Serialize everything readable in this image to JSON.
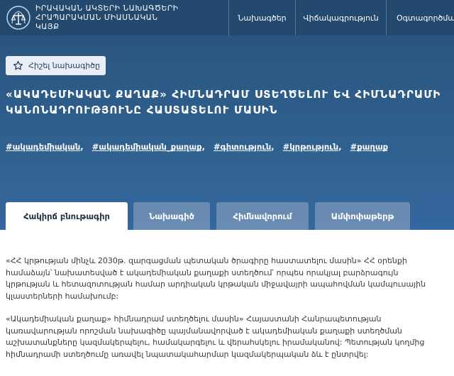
{
  "header": {
    "org_line1": "ԻՐԱՎԱԿԱՆ ԱԿՏԵՐԻ ՆԱԽԱԳԾԵՐԻ",
    "org_line2": "ՀՐԱՊԱՐԱԿՄԱՆ ՄԻԱՍՆԱԿԱՆ",
    "org_line3": "ԿԱՅՔ",
    "nav": [
      "Նախագծեր",
      "Վիճակագրություն",
      "Օգտագործման"
    ]
  },
  "favorite_label": "Հիշել նախագիծը",
  "title": "«ԱԿԱԴԵՄԻԱԿԱՆ ՔԱՂԱՔ» ՀԻՄՆԱԴՐԱՄ ՍՏԵՂԾԵԼՈՒ ԵՎ ՀԻՄՆԱԴՐԱՄԻ ԿԱՆՈՆԱԴՐՈՒԹՅՈՒՆԸ ՀԱՍՏԱՏԵԼՈՒ ՄԱՍԻՆ",
  "tags": [
    "#ակադեմիական",
    "#ակադեմիական_քաղաք",
    "#գիտություն",
    "#կրթություն",
    "#քաղաք"
  ],
  "tabs": [
    "Հակիրճ բնութագիր",
    "Նախագիծ",
    "Հիմնավորում",
    "Ամփոփաթերթ"
  ],
  "active_tab": 0,
  "content": {
    "p1": "«ՀՀ կրթության մինչև 2030թ. զարգացման պետական ծրագիրը հաստատելու մասին» ՀՀ օրենքի համաձայն՝ նախատեսված է ակադեմիական քաղաքի ստեղծում՝ որպես որակյալ բարձրագույն կրթության և հետազոտության համար արդիական կրթական միջավայրի ապահովման կամպուսային կլաստերների համախումբ:",
    "p2": "«Ակադեմիական քաղաք» հիմնադրամ ստեղծելու մասին» Հայաստանի Հանրապետության կառավարության որոշման նախագիծը պայմանավորված է ակադեմիական քաղաքի ստեղծման աշխատանքները կազմակերպելու, համակարգելու և վերահսկելու իրամականով: Պետության կողմից հիմնադրամի ստեղծումը առավել նպատակահարմար կազմակերպական ձև է ընտրվել:"
  }
}
